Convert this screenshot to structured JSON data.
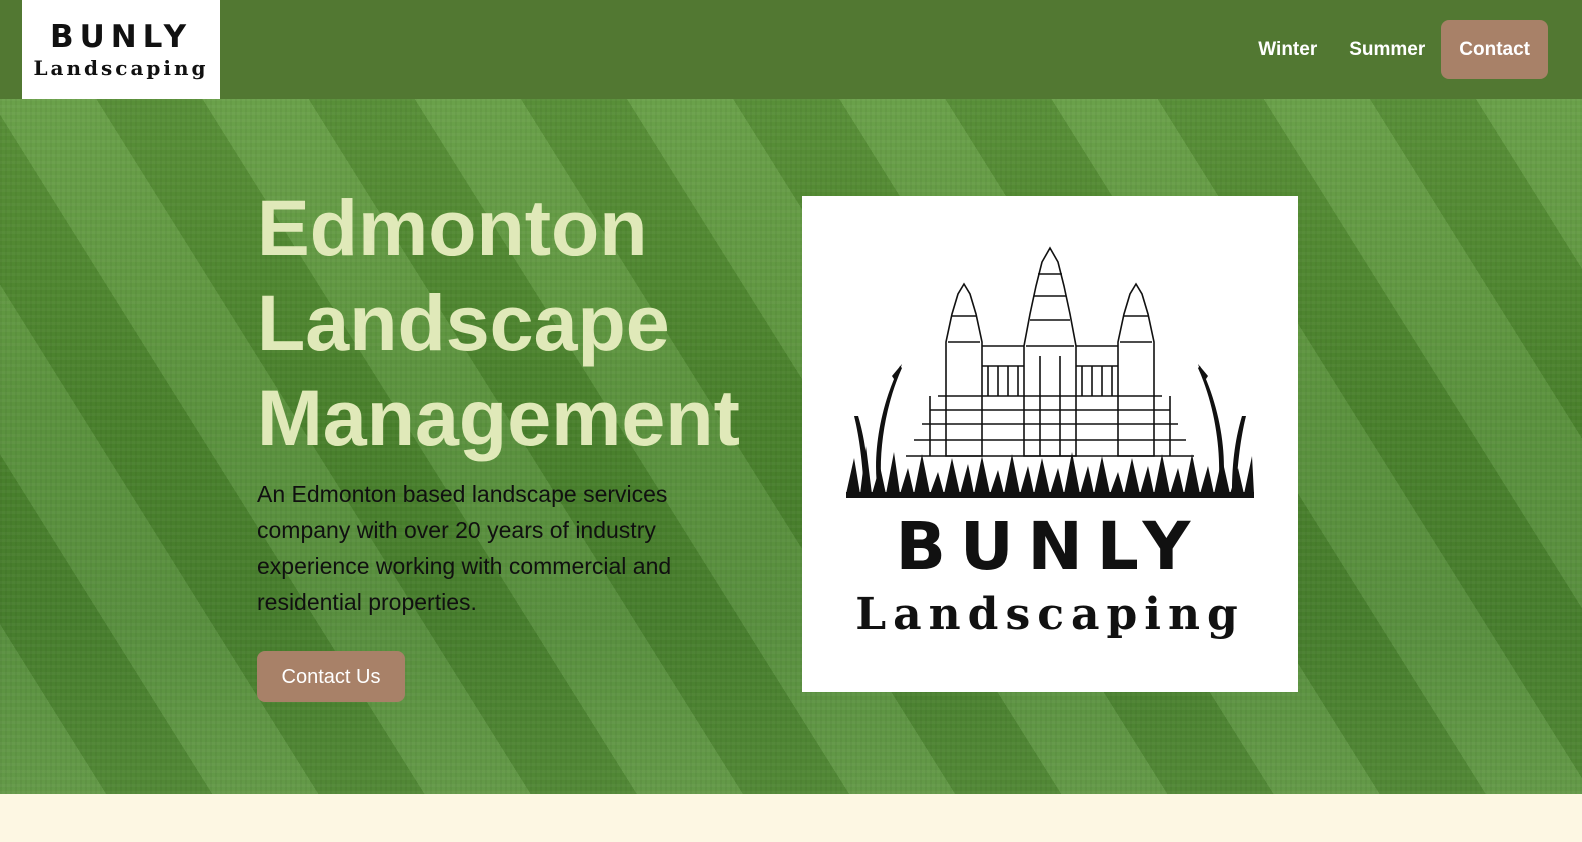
{
  "nav": {
    "brand": "BUNLY",
    "brand_sub": "Landscaping",
    "links": [
      {
        "label": "Winter"
      },
      {
        "label": "Summer"
      }
    ],
    "contact_label": "Contact"
  },
  "hero": {
    "title_lines": [
      "Edmonton",
      "Landscape",
      "Management"
    ],
    "description": "An Edmonton based landscape services company with over 20 years of industry experience working with commercial and residential properties.",
    "cta_label": "Contact Us",
    "logo_brand": "BUNLY",
    "logo_sub": "Landscaping"
  },
  "colors": {
    "nav_bg": "#527832",
    "accent_brown": "#a88168",
    "title_color": "#e0e9b9",
    "footer_bg": "#fdf7e3"
  },
  "icons": {
    "temple": "temple-logo-icon",
    "grass": "grass-icon"
  }
}
